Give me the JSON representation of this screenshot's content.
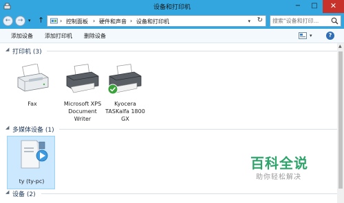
{
  "window": {
    "title": "设备和打印机",
    "min_symbol": "−",
    "max_symbol": "□",
    "close_symbol": "✕"
  },
  "address": {
    "breadcrumbs": [
      "控制面板",
      "硬件和声音",
      "设备和打印机"
    ],
    "separator": "›",
    "search_placeholder": "搜索\"设备和打印...",
    "nav_back": "←",
    "nav_forward": "→",
    "up": "↑"
  },
  "toolbar": {
    "add_device": "添加设备",
    "add_printer": "添加打印机",
    "remove_device": "删除设备",
    "help": "?"
  },
  "groups": [
    {
      "label": "打印机 (3)",
      "devices": [
        {
          "name": "Fax",
          "icon": "fax-icon"
        },
        {
          "name": "Microsoft XPS Document Writer",
          "lines": [
            "Microsoft XPS",
            "Document",
            "Writer"
          ],
          "icon": "printer-icon"
        },
        {
          "name": "Kyocera TASKalfa 1800 GX",
          "lines": [
            "Kyocera",
            "TASKalfa 1800",
            "GX"
          ],
          "icon": "printer-default-icon",
          "default": true
        }
      ]
    },
    {
      "label": "多媒体设备 (1)",
      "devices": [
        {
          "name": "ty (ty-pc)",
          "icon": "media-server-icon",
          "selected": true
        }
      ]
    },
    {
      "label": "设备 (2)",
      "devices": []
    }
  ],
  "watermark": {
    "main": "百科全说",
    "sub": "助你轻松解决"
  },
  "colors": {
    "titlebar": "#33a6e0",
    "close": "#c7332a",
    "selection": "#cce8ff",
    "watermark": "#2ea46b"
  }
}
